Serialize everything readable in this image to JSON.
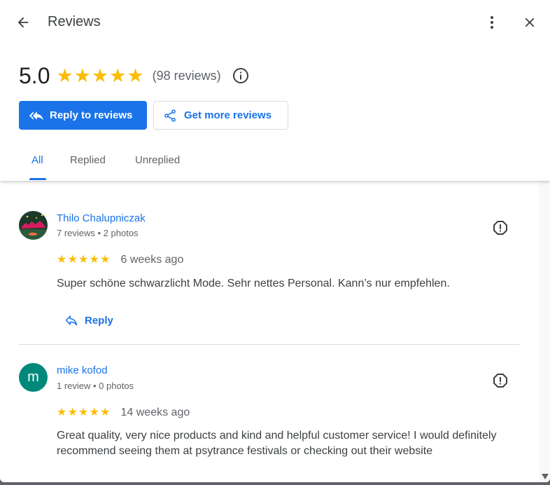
{
  "header": {
    "title": "Reviews"
  },
  "summary": {
    "rating": "5.0",
    "stars": 5,
    "review_count": "(98 reviews)"
  },
  "actions": {
    "reply_label": "Reply to reviews",
    "get_more_label": "Get more reviews"
  },
  "tabs": [
    {
      "label": "All",
      "active": true
    },
    {
      "label": "Replied",
      "active": false
    },
    {
      "label": "Unreplied",
      "active": false
    }
  ],
  "reviews": [
    {
      "name": "Thilo Chalupniczak",
      "meta": "7 reviews • 2 photos",
      "stars": 5,
      "when": "6 weeks ago",
      "text": "Super schöne schwarzlicht Mode. Sehr nettes Personal. Kann’s nur empfehlen.",
      "reply_label": "Reply"
    },
    {
      "name": "mike kofod",
      "avatar_letter": "m",
      "meta": "1 review • 0 photos",
      "stars": 5,
      "when": "14 weeks ago",
      "text": "Great quality, very nice products and kind and helpful customer service! I would definitely recommend seeing them at psytrance festivals or checking out their website"
    }
  ],
  "colors": {
    "accent": "#1a73e8",
    "star": "#fbbc04",
    "avatar_m": "#00897b"
  }
}
